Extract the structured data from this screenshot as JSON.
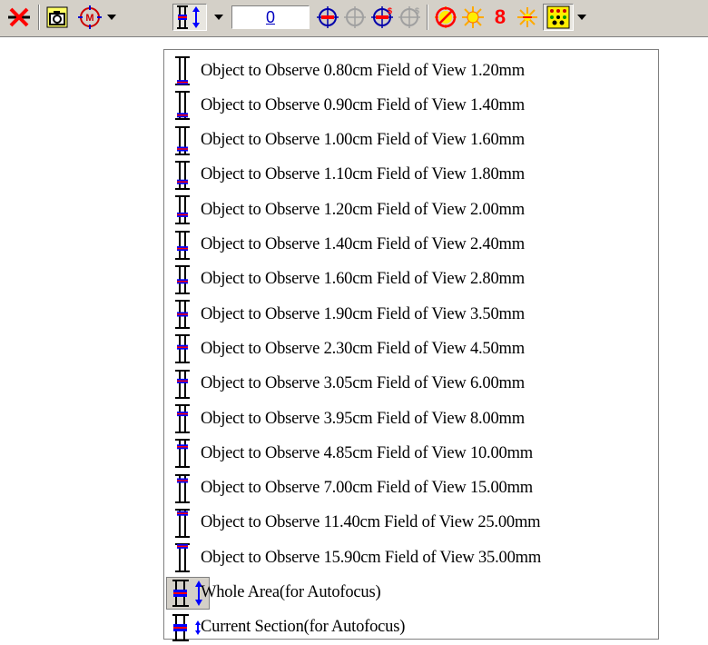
{
  "toolbar": {
    "zoom_value": "0",
    "number_icon_text": "8"
  },
  "menu": {
    "items": [
      {
        "label": "Object to Observe 0.80cm Field of View 1.20mm",
        "mark_fraction": 0.92
      },
      {
        "label": "Object to Observe 0.90cm Field of View 1.40mm",
        "mark_fraction": 0.86
      },
      {
        "label": "Object to Observe 1.00cm Field of View 1.60mm",
        "mark_fraction": 0.8
      },
      {
        "label": "Object to Observe 1.10cm Field of View 1.80mm",
        "mark_fraction": 0.74
      },
      {
        "label": "Object to Observe 1.20cm Field of View 2.00mm",
        "mark_fraction": 0.68
      },
      {
        "label": "Object to Observe 1.40cm Field of View 2.40mm",
        "mark_fraction": 0.62
      },
      {
        "label": "Object to Observe 1.60cm Field of View 2.80mm",
        "mark_fraction": 0.56
      },
      {
        "label": "Object to Observe 1.90cm Field of View 3.50mm",
        "mark_fraction": 0.5
      },
      {
        "label": "Object to Observe 2.30cm Field of View 4.50mm",
        "mark_fraction": 0.44
      },
      {
        "label": "Object to Observe 3.05cm Field of View 6.00mm",
        "mark_fraction": 0.38
      },
      {
        "label": "Object to Observe 3.95cm Field of View 8.00mm",
        "mark_fraction": 0.32
      },
      {
        "label": "Object to Observe 4.85cm Field of View 10.00mm",
        "mark_fraction": 0.26
      },
      {
        "label": "Object to Observe 7.00cm Field of View 15.00mm",
        "mark_fraction": 0.2
      },
      {
        "label": "Object to Observe 11.40cm Field of View 25.00mm",
        "mark_fraction": 0.14
      },
      {
        "label": "Object to Observe 15.90cm Field of View 35.00mm",
        "mark_fraction": 0.08
      }
    ],
    "whole_area_label": "Whole Area(for Autofocus)",
    "current_section_label": "Current Section(for Autofocus)"
  },
  "colors": {
    "toolbar_bg": "#d4d0c8",
    "accent_red": "#ff0000",
    "accent_blue": "#0000ff",
    "link_blue": "#0000c0"
  }
}
